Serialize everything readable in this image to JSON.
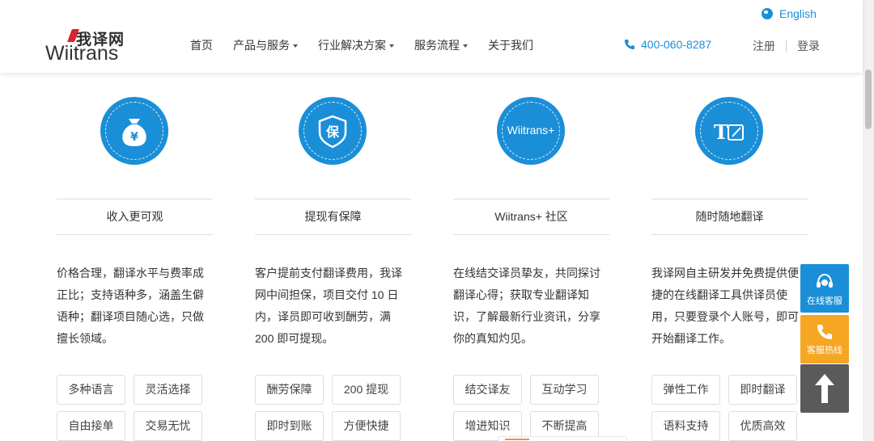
{
  "header": {
    "logo_cn": "我译网",
    "logo_en": "Wiitrans",
    "nav": [
      "首页",
      "产品与服务",
      "行业解决方案",
      "服务流程",
      "关于我们"
    ],
    "language": "English",
    "phone": "400-060-8287",
    "register": "注册",
    "login": "登录"
  },
  "columns": [
    {
      "icon": "money-bag-icon",
      "title": "收入更可观",
      "desc": "价格合理，翻译水平与费率成正比；支持语种多，涵盖生僻语种；翻译项目随心选，只做擅长领域。",
      "tags": [
        "多种语言",
        "灵活选择",
        "自由接单",
        "交易无忧"
      ]
    },
    {
      "icon": "shield-icon",
      "title": "提现有保障",
      "desc": "客户提前支付翻译费用，我译网中间担保，项目交付 10 日内，译员即可收到酬劳，满 200 即可提现。",
      "tags": [
        "酬劳保障",
        "200 提现",
        "即时到账",
        "方便快捷"
      ]
    },
    {
      "icon": "wiitrans-plus-icon",
      "brand": "Wiitrans+",
      "title": "Wiitrans+ 社区",
      "desc": "在线结交译员挚友，共同探讨翻译心得；获取专业翻译知识，了解最新行业资讯，分享你的真知灼见。",
      "tags": [
        "结交译友",
        "互动学习",
        "增进知识",
        "不断提高"
      ]
    },
    {
      "icon": "translate-edit-icon",
      "title": "随时随地翻译",
      "desc": "我译网自主研发并免费提供便捷的在线翻译工具供译员使用，只要登录个人账号，即可开始翻译工作。",
      "tags": [
        "弹性工作",
        "即时翻译",
        "语料支持",
        "优质高效"
      ]
    }
  ],
  "float": {
    "service": "在线客服",
    "hotline": "客服热线"
  },
  "colors": {
    "accent": "#1a8fd8",
    "hotline": "#f5a623",
    "top": "#5a5a5a"
  }
}
